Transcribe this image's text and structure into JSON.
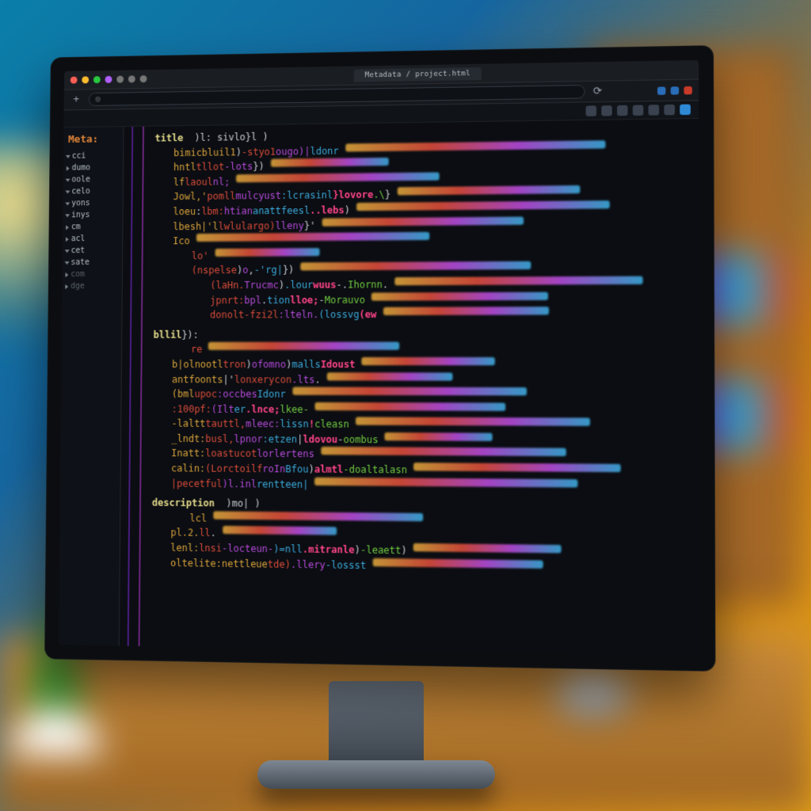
{
  "window": {
    "tab_label": "Metadata / project.html",
    "url_display": "◎"
  },
  "sidebar": {
    "header": "Meta:",
    "items": [
      {
        "label": "cci",
        "open": true
      },
      {
        "label": "dumo",
        "open": false
      },
      {
        "label": "oole",
        "open": true
      },
      {
        "label": "celo",
        "open": true
      },
      {
        "label": "yons",
        "open": true
      },
      {
        "label": "inys",
        "open": true
      },
      {
        "label": "cm",
        "open": false
      },
      {
        "label": "acl",
        "open": false
      },
      {
        "label": "cet",
        "open": true
      },
      {
        "label": "sate",
        "open": true
      },
      {
        "label": "com",
        "open": false,
        "dim": true
      },
      {
        "label": "dge",
        "open": false,
        "dim": true
      }
    ]
  },
  "code": {
    "section1_kw": "title",
    "section1_tail": "  )l: sivlo}l )",
    "section2_kw": "bllil",
    "section2_tail": "}):",
    "section3_kw": "description",
    "section3_tail": "  )mo| )",
    "lines_a": [
      "bimicbluil1 ) -styo1  ougo)|  ldonr",
      "hntl  tllot -lots } )",
      "lf laoul  nl;",
      "Jowl,' pomll  mulcyust :lcrasinl  }lovore .\\ }",
      "loeu : lbm: htian  anattfeesl ..lebs )",
      "lbesh|'l  lwlulargo)  lleny }'",
      "Ico",
      " lo'",
      "  (nspelse )  o , -'rg| } )",
      "   (laHn. Trucmc ) .lour wuus -  . Ihornn  .",
      "   jpnrt: bpl    . tion  lloe; - Morauvo",
      "   donolt-fzi2l :lteln. (lossvg  (ew"
    ],
    "lines_b": [
      " re",
      "b|olnootl  tron )  ofomno ) malls   Idoust",
      "antfoonts |' lonxerycon  .lts .",
      "(bml  upoc :occbes  Idonr",
      "  :100pf: (Ilt er  .lnce;  lkee-",
      "-laltt tauttl, mleec: lissn !   cleasn",
      "_lndt: busl, lpnor :etzen |  ldovou -   oombus",
      "Inatt: loastucot  lorlertens",
      "calin: (Lorctoilf  roIn Bfou )  almtl -doaltalasn",
      "     |pecetful )l.inl  rentteen|"
    ],
    "lines_c": [
      "lcl",
      "pl.2. ll .",
      "lenl:  lnsi -locteun-  )=nll .mitranle  ) -leaett  )",
      "oltelite:nettleue  tde) .llery -lossst"
    ]
  }
}
